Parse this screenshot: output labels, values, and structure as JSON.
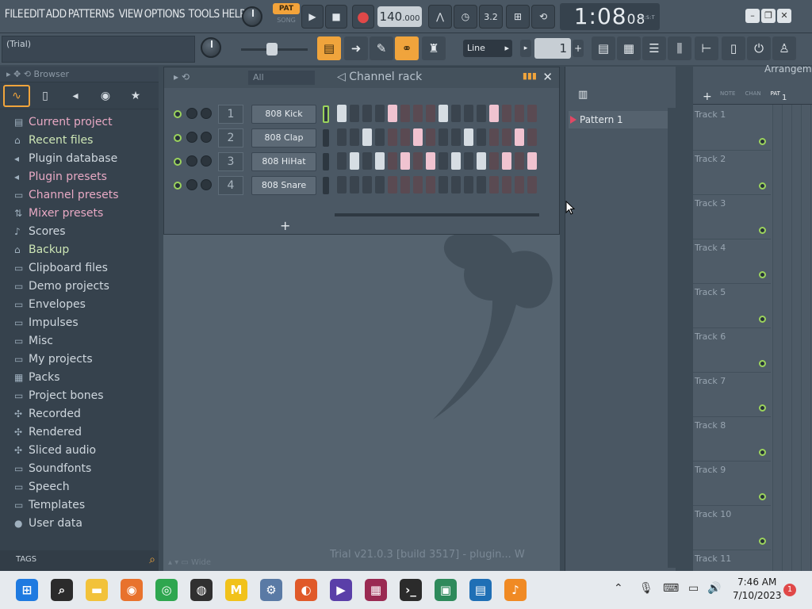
{
  "menu": [
    "FILE",
    "EDIT",
    "ADD",
    "PATTERNS",
    "VIEW",
    "OPTIONS",
    "TOOLS",
    "HELP"
  ],
  "transport": {
    "pat_label": "PAT",
    "song_label": "SONG",
    "tempo_main": "140",
    "tempo_frac": ".000",
    "time_main": "1:08",
    "time_frac": "08",
    "time_zone": "B:S:T",
    "beat_readout": "3.2"
  },
  "toolbar2": {
    "hint": "(Trial)",
    "snap": "Line",
    "pattern_number": "1",
    "pattern_plus": "+"
  },
  "browser": {
    "title": "Browser",
    "tabs": [
      "all",
      "files",
      "plugins",
      "web",
      "favorites"
    ],
    "items": [
      {
        "label": "Current project",
        "style": "hl",
        "icon": "▤"
      },
      {
        "label": "Recent files",
        "style": "gr",
        "icon": "⌂"
      },
      {
        "label": "Plugin database",
        "style": "",
        "icon": "◂"
      },
      {
        "label": "Plugin presets",
        "style": "hl",
        "icon": "◂"
      },
      {
        "label": "Channel presets",
        "style": "hl",
        "icon": "▭"
      },
      {
        "label": "Mixer presets",
        "style": "hl",
        "icon": "⇅"
      },
      {
        "label": "Scores",
        "style": "",
        "icon": "♪"
      },
      {
        "label": "Backup",
        "style": "gr",
        "icon": "⌂"
      },
      {
        "label": "Clipboard files",
        "style": "",
        "icon": "▭"
      },
      {
        "label": "Demo projects",
        "style": "",
        "icon": "▭"
      },
      {
        "label": "Envelopes",
        "style": "",
        "icon": "▭"
      },
      {
        "label": "Impulses",
        "style": "",
        "icon": "▭"
      },
      {
        "label": "Misc",
        "style": "",
        "icon": "▭"
      },
      {
        "label": "My projects",
        "style": "",
        "icon": "▭"
      },
      {
        "label": "Packs",
        "style": "",
        "icon": "▦"
      },
      {
        "label": "Project bones",
        "style": "",
        "icon": "▭"
      },
      {
        "label": "Recorded",
        "style": "",
        "icon": "✣"
      },
      {
        "label": "Rendered",
        "style": "",
        "icon": "✣"
      },
      {
        "label": "Sliced audio",
        "style": "",
        "icon": "✣"
      },
      {
        "label": "Soundfonts",
        "style": "",
        "icon": "▭"
      },
      {
        "label": "Speech",
        "style": "",
        "icon": "▭"
      },
      {
        "label": "Templates",
        "style": "",
        "icon": "▭"
      },
      {
        "label": "User data",
        "style": "",
        "icon": "●"
      }
    ],
    "tags_label": "TAGS"
  },
  "channel_rack": {
    "filter": "All",
    "title": "Channel rack",
    "add": "+",
    "channels": [
      {
        "num": "1",
        "name": "808 Kick",
        "selected": true,
        "steps": [
          "on-a",
          "off-a",
          "off-a",
          "off-a",
          "on-b",
          "off-b",
          "off-b",
          "off-b",
          "on-a",
          "off-a",
          "off-a",
          "off-a",
          "on-b",
          "off-b",
          "off-b",
          "off-b"
        ]
      },
      {
        "num": "2",
        "name": "808 Clap",
        "selected": false,
        "steps": [
          "off-a",
          "off-a",
          "on-a",
          "off-a",
          "off-b",
          "off-b",
          "on-b",
          "off-b",
          "off-a",
          "off-a",
          "on-a",
          "off-a",
          "off-b",
          "off-b",
          "on-b",
          "off-b"
        ]
      },
      {
        "num": "3",
        "name": "808 HiHat",
        "selected": false,
        "steps": [
          "off-a",
          "on-a",
          "off-a",
          "on-a",
          "off-b",
          "on-b",
          "off-b",
          "on-b",
          "off-a",
          "on-a",
          "off-a",
          "on-a",
          "off-b",
          "on-b",
          "off-b",
          "on-b"
        ]
      },
      {
        "num": "4",
        "name": "808 Snare",
        "selected": false,
        "steps": [
          "off-a",
          "off-a",
          "off-a",
          "off-a",
          "off-b",
          "off-b",
          "off-b",
          "off-b",
          "off-a",
          "off-a",
          "off-a",
          "off-a",
          "off-b",
          "off-b",
          "off-b",
          "off-b"
        ]
      }
    ]
  },
  "workspace": {
    "watermark": "Trial v21.0.3 [build 3517] - plugin... W",
    "bottom_label": "Wide"
  },
  "patterns": {
    "items": [
      "Pattern 1"
    ]
  },
  "playlist": {
    "title": "Arrangement",
    "tabs": [
      "NOTE",
      "CHAN",
      "PAT"
    ],
    "active_tab": "PAT",
    "ruler_start": "1",
    "tracks": [
      "Track 1",
      "Track 2",
      "Track 3",
      "Track 4",
      "Track 5",
      "Track 6",
      "Track 7",
      "Track 8",
      "Track 9",
      "Track 10",
      "Track 11"
    ]
  },
  "taskbar": {
    "apps": [
      {
        "name": "start",
        "glyph": "⊞",
        "color": "#1f7ae0"
      },
      {
        "name": "search",
        "glyph": "⌕",
        "color": "#2b2b2b"
      },
      {
        "name": "file-explorer",
        "glyph": "▬",
        "color": "#f2c23a"
      },
      {
        "name": "firefox",
        "glyph": "◉",
        "color": "#e8722d"
      },
      {
        "name": "chrome",
        "glyph": "◎",
        "color": "#2ea64f"
      },
      {
        "name": "obs",
        "glyph": "◍",
        "color": "#303030"
      },
      {
        "name": "m-app",
        "glyph": "M",
        "color": "#f1c21b"
      },
      {
        "name": "settings",
        "glyph": "⚙",
        "color": "#5a7aa5"
      },
      {
        "name": "audacity",
        "glyph": "◐",
        "color": "#e05a2a"
      },
      {
        "name": "video-editor",
        "glyph": "▶",
        "color": "#5a3fa8"
      },
      {
        "name": "winrar",
        "glyph": "▦",
        "color": "#9a2a52"
      },
      {
        "name": "terminal",
        "glyph": "›_",
        "color": "#2b2b2b"
      },
      {
        "name": "screen-app",
        "glyph": "▣",
        "color": "#2e8a5b"
      },
      {
        "name": "media-app",
        "glyph": "▤",
        "color": "#1f6fb5"
      },
      {
        "name": "fl-studio",
        "glyph": "♪",
        "color": "#f08a24"
      }
    ],
    "time": "7:46 AM",
    "date": "7/10/2023",
    "notifications": "1"
  }
}
